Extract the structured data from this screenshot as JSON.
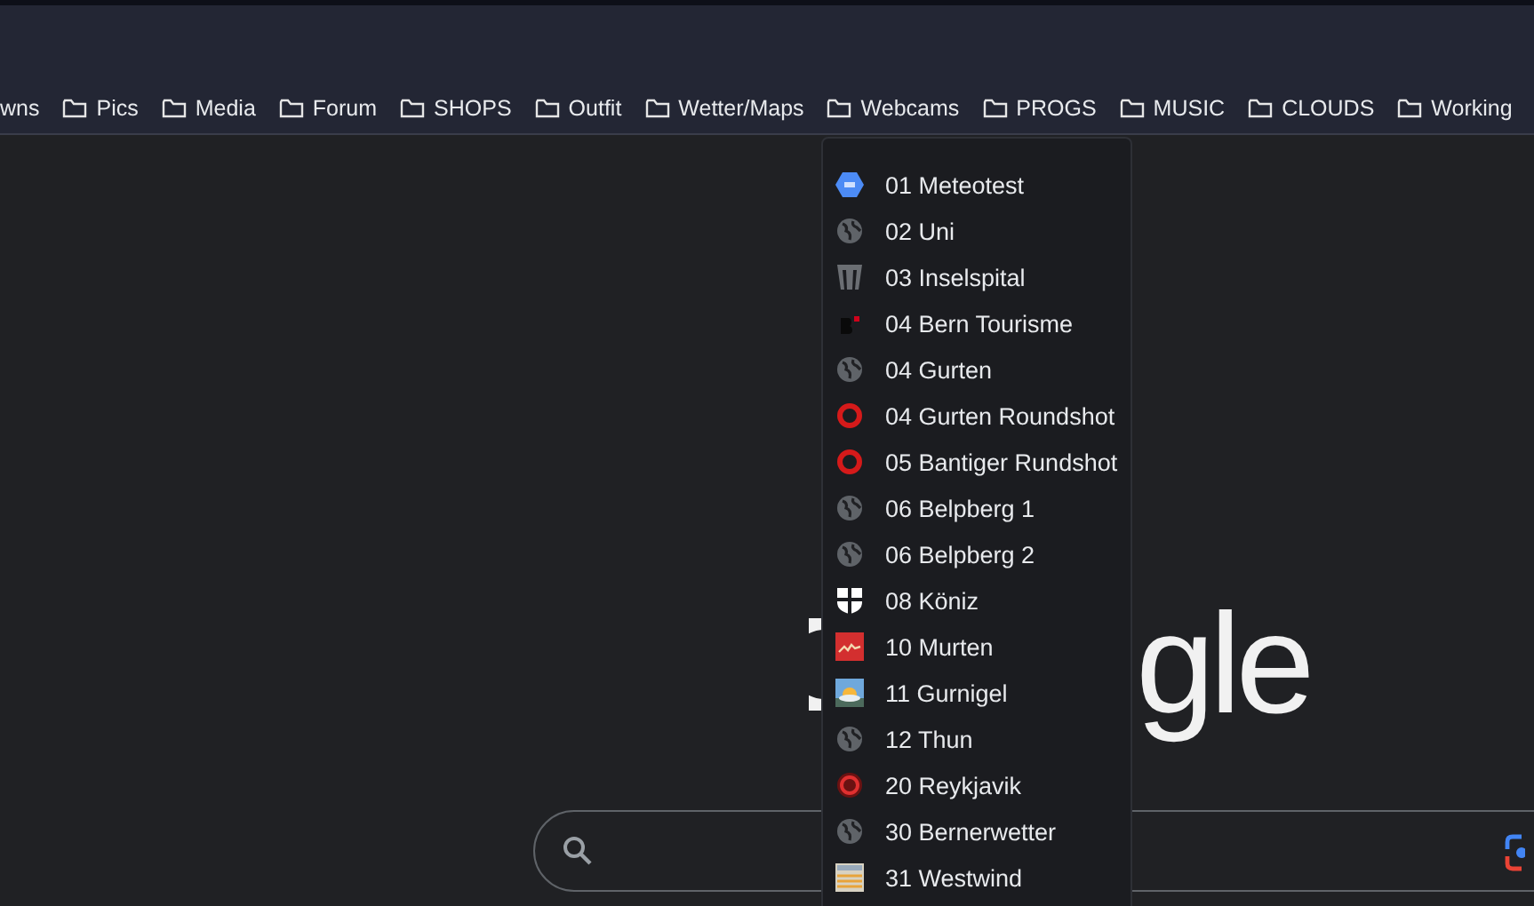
{
  "bookmarks": [
    {
      "label": "wns",
      "folder": false
    },
    {
      "label": "Pics",
      "folder": true
    },
    {
      "label": "Media",
      "folder": true
    },
    {
      "label": "Forum",
      "folder": true
    },
    {
      "label": "SHOPS",
      "folder": true
    },
    {
      "label": "Outfit",
      "folder": true
    },
    {
      "label": "Wetter/Maps",
      "folder": true
    },
    {
      "label": "Webcams",
      "folder": true
    },
    {
      "label": "PROGS",
      "folder": true
    },
    {
      "label": "MUSIC",
      "folder": true
    },
    {
      "label": "CLOUDS",
      "folder": true
    },
    {
      "label": "Working",
      "folder": true
    }
  ],
  "menu": [
    {
      "label": "01 Meteotest",
      "kind": "hexagon"
    },
    {
      "label": "02 Uni",
      "kind": "globe"
    },
    {
      "label": "03 Inselspital",
      "kind": "pillars"
    },
    {
      "label": "04 Bern Tourisme",
      "kind": "b-logo"
    },
    {
      "label": "04 Gurten",
      "kind": "globe"
    },
    {
      "label": "04 Gurten Roundshot",
      "kind": "ring"
    },
    {
      "label": "05 Bantiger Rundshot",
      "kind": "ring"
    },
    {
      "label": "06 Belpberg 1",
      "kind": "globe"
    },
    {
      "label": "06 Belpberg 2",
      "kind": "globe"
    },
    {
      "label": "08 Köniz",
      "kind": "shield"
    },
    {
      "label": "10 Murten",
      "kind": "flag"
    },
    {
      "label": "11 Gurnigel",
      "kind": "weather"
    },
    {
      "label": "12 Thun",
      "kind": "globe"
    },
    {
      "label": "20 Reykjavik",
      "kind": "target"
    },
    {
      "label": "30 Bernerwetter",
      "kind": "globe"
    },
    {
      "label": "31 Westwind",
      "kind": "table"
    }
  ],
  "logo": {
    "text": "gle"
  }
}
